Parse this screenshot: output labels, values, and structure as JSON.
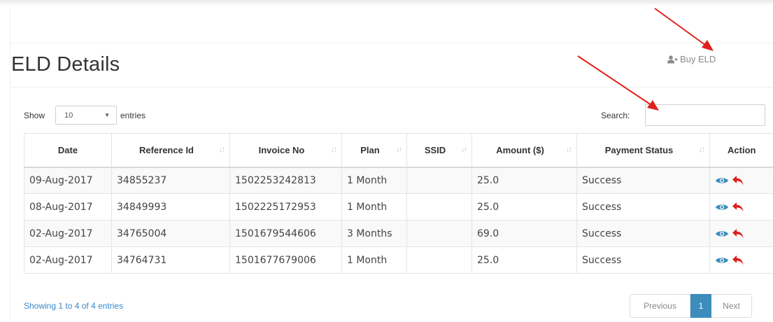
{
  "page": {
    "title": "ELD Details"
  },
  "header": {
    "buy_label": "Buy ELD",
    "buy_icon": "user-add-icon"
  },
  "controls": {
    "show_label": "Show",
    "length_value": "10",
    "entries_label": "entries",
    "search_label": "Search:",
    "search_value": ""
  },
  "table": {
    "columns": [
      "Date",
      "Reference Id",
      "Invoice No",
      "Plan",
      "SSID",
      "Amount ($)",
      "Payment Status",
      "Action"
    ],
    "rows": [
      [
        "09-Aug-2017",
        "34855237",
        "1502253242813",
        "1 Month",
        "",
        "25.0",
        "Success"
      ],
      [
        "08-Aug-2017",
        "34849993",
        "1502225172953",
        "1 Month",
        "",
        "25.0",
        "Success"
      ],
      [
        "02-Aug-2017",
        "34765004",
        "1501679544606",
        "3 Months",
        "",
        "69.0",
        "Success"
      ],
      [
        "02-Aug-2017",
        "34764731",
        "1501677679006",
        "1 Month",
        "",
        "25.0",
        "Success"
      ]
    ],
    "action_icons": [
      "eye-icon",
      "reply-arrow-icon"
    ]
  },
  "footer": {
    "info": "Showing 1 to 4 of 4 entries",
    "prev_label": "Previous",
    "current_page": "1",
    "next_label": "Next"
  },
  "colors": {
    "accent": "#3c8dbc",
    "link": "#3a87c8",
    "annotation": "#e0201c",
    "action_view": "#3c8dbc",
    "action_refund": "#dd1f1f"
  }
}
